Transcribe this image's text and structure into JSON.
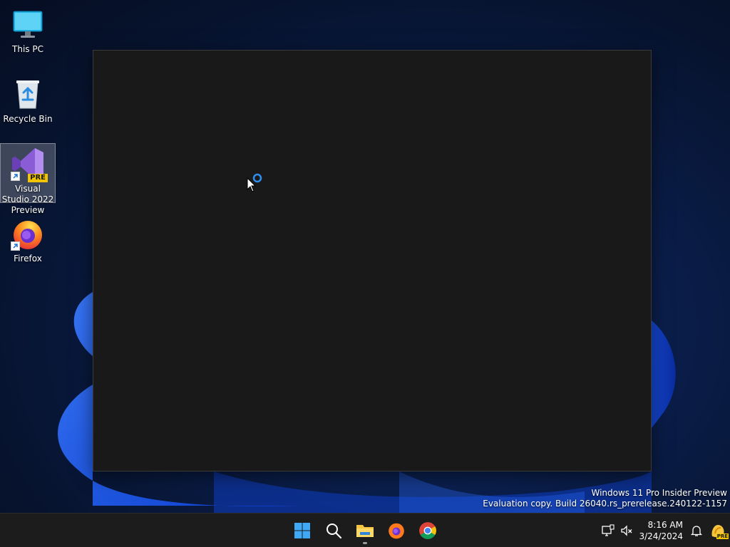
{
  "desktop": {
    "icons": [
      {
        "label": "This PC"
      },
      {
        "label": "Recycle Bin"
      },
      {
        "label": "Visual Studio 2022 Preview",
        "badge": "PRE"
      },
      {
        "label": "Firefox"
      }
    ]
  },
  "watermark": {
    "line1": "Windows 11 Pro Insider Preview",
    "line2": "Evaluation copy. Build 26040.rs_prerelease.240122-1157"
  },
  "taskbar": {
    "pinned": [
      "start-icon",
      "search-icon",
      "file-explorer-icon",
      "firefox-icon",
      "chrome-icon"
    ],
    "tray": {
      "time": "8:16 AM",
      "date": "3/24/2024",
      "badge": "PRE"
    }
  },
  "colors": {
    "accent": "#0078d4",
    "taskbar": "#1c1c1c",
    "window": "#191919"
  }
}
